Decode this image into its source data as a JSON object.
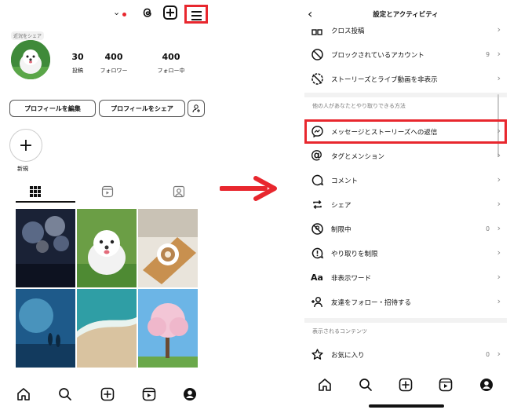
{
  "left": {
    "note": "近況をシェア",
    "stats": [
      {
        "value": "30",
        "label": "投稿"
      },
      {
        "value": "400",
        "label": "フォロワー"
      },
      {
        "value": "400",
        "label": "フォロー中"
      }
    ],
    "edit_profile": "プロフィールを編集",
    "share_profile": "プロフィールをシェア",
    "new_label": "新規"
  },
  "right": {
    "title": "設定とアクティビティ",
    "items_top": [
      {
        "label": "クロス投稿",
        "count": ""
      },
      {
        "label": "ブロックされているアカウント",
        "count": "9"
      },
      {
        "label": "ストーリーズとライブ動画を非表示",
        "count": ""
      }
    ],
    "section1": "他の人があなたとやり取りできる方法",
    "items_mid": [
      {
        "label": "メッセージとストーリーズへの返信",
        "count": ""
      },
      {
        "label": "タグとメンション",
        "count": ""
      },
      {
        "label": "コメント",
        "count": ""
      },
      {
        "label": "シェア",
        "count": ""
      },
      {
        "label": "制限中",
        "count": "0"
      },
      {
        "label": "やり取りを制限",
        "count": ""
      },
      {
        "label": "非表示ワード",
        "count": ""
      },
      {
        "label": "友達をフォロー・招待する",
        "count": ""
      }
    ],
    "section2": "表示されるコンテンツ",
    "items_bottom": [
      {
        "label": "お気に入り",
        "count": "0"
      }
    ],
    "hidden_words_icon_text": "Aa"
  },
  "colors": {
    "highlight": "#e8272e",
    "arrow": "#e8272e"
  }
}
